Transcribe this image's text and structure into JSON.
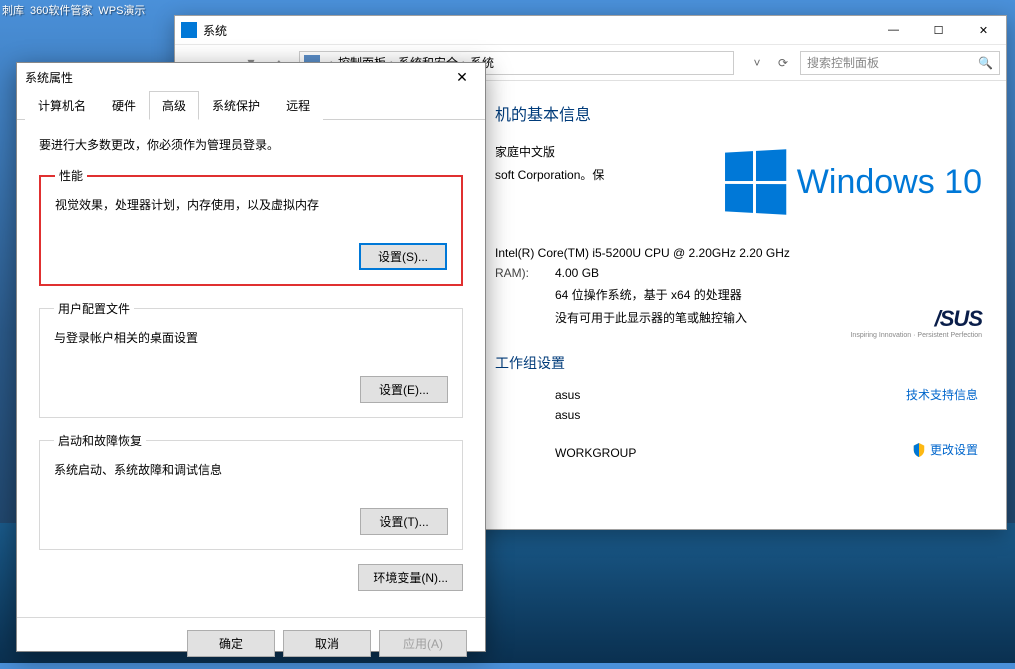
{
  "desktop": {
    "icons": [
      "刺库",
      "360软件管家",
      "WPS演示"
    ]
  },
  "bg_window": {
    "title": "系统",
    "breadcrumb": [
      "控制面板",
      "系统和安全",
      "系统"
    ],
    "search_placeholder": "搜索控制面板",
    "heading_suffix": "机的基本信息",
    "edition_suffix": "家庭中文版",
    "copyright_suffix": "soft Corporation。保",
    "win10_text": "Windows 10",
    "specs": {
      "cpu": "Intel(R) Core(TM) i5-5200U CPU @ 2.20GHz 2.20 GHz",
      "ram_label": "RAM):",
      "ram": "4.00 GB",
      "arch": "64 位操作系统，基于 x64 的处理器",
      "touch": "没有可用于此显示器的笔或触控输入"
    },
    "support_link": "技术支持信息",
    "group_heading": "工作组设置",
    "computer": "asus",
    "full_name": "asus",
    "workgroup": "WORKGROUP",
    "change_link": "更改设置",
    "asus": {
      "brand": "/SUS",
      "tag": "Inspiring Innovation · Persistent Perfection"
    }
  },
  "dialog": {
    "title": "系统属性",
    "tabs": [
      "计算机名",
      "硬件",
      "高级",
      "系统保护",
      "远程"
    ],
    "active_tab": 2,
    "note": "要进行大多数更改，你必须作为管理员登录。",
    "perf": {
      "legend": "性能",
      "desc": "视觉效果，处理器计划，内存使用，以及虚拟内存",
      "btn": "设置(S)..."
    },
    "profile": {
      "legend": "用户配置文件",
      "desc": "与登录帐户相关的桌面设置",
      "btn": "设置(E)..."
    },
    "startup": {
      "legend": "启动和故障恢复",
      "desc": "系统启动、系统故障和调试信息",
      "btn": "设置(T)..."
    },
    "env_btn": "环境变量(N)...",
    "ok": "确定",
    "cancel": "取消",
    "apply": "应用(A)"
  }
}
